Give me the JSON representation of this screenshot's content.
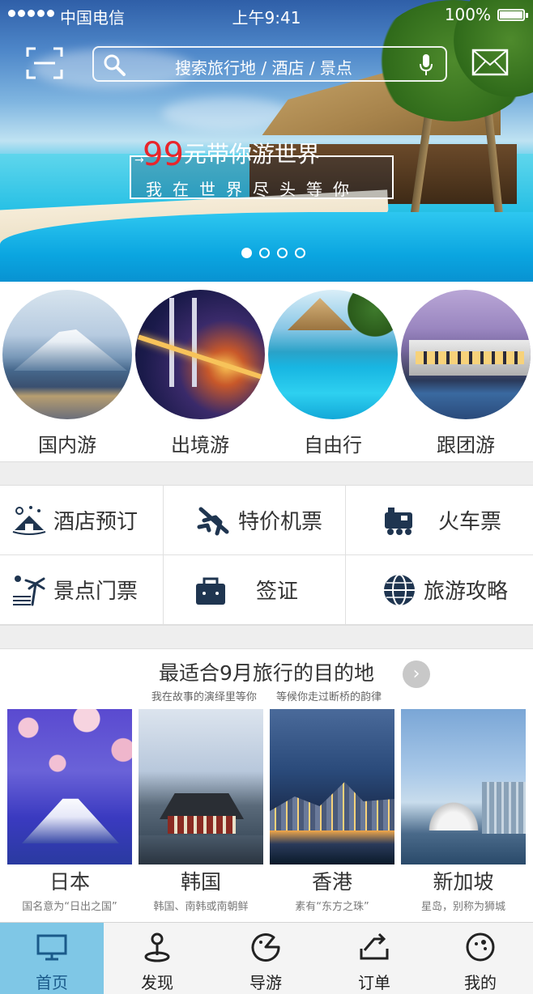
{
  "statusbar": {
    "carrier": "中国电信",
    "time": "上午9:41",
    "battery": "100%"
  },
  "search": {
    "placeholder": "搜索旅行地 / 酒店 / 景点"
  },
  "banner": {
    "number": "99",
    "headline": "元带你游世界",
    "subline": "我在世界尽头等你",
    "page_count": 4,
    "active_page": 1
  },
  "categories": [
    {
      "label": "国内游"
    },
    {
      "label": "出境游"
    },
    {
      "label": "自由行"
    },
    {
      "label": "跟团游"
    }
  ],
  "services": [
    {
      "label": "酒店预订",
      "icon": "hotel-icon"
    },
    {
      "label": "特价机票",
      "icon": "airplane-icon"
    },
    {
      "label": "火车票",
      "icon": "train-icon"
    },
    {
      "label": "景点门票",
      "icon": "attraction-icon"
    },
    {
      "label": "签证",
      "icon": "visa-bag-icon"
    },
    {
      "label": "旅游攻略",
      "icon": "globe-icon"
    }
  ],
  "destinations": {
    "title": "最适合9月旅行的目的地",
    "subtitle": "我在故事的演绎里等你  等候你走过断桥的韵律",
    "items": [
      {
        "name": "日本",
        "desc": "国名意为“日出之国”"
      },
      {
        "name": "韩国",
        "desc": "韩国、南韩或南朝鲜"
      },
      {
        "name": "香港",
        "desc": "素有“东方之珠”"
      },
      {
        "name": "新加坡",
        "desc": "星岛，别称为狮城"
      }
    ]
  },
  "tabbar": [
    {
      "label": "首页",
      "icon": "monitor-icon",
      "active": true
    },
    {
      "label": "发现",
      "icon": "location-pin-icon",
      "active": false
    },
    {
      "label": "导游",
      "icon": "guide-icon",
      "active": false
    },
    {
      "label": "订单",
      "icon": "order-icon",
      "active": false
    },
    {
      "label": "我的",
      "icon": "profile-icon",
      "active": false
    }
  ],
  "colors": {
    "accent": "#7fc7e6",
    "promo_number": "#e8262c",
    "icon_dark": "#1f3550"
  }
}
